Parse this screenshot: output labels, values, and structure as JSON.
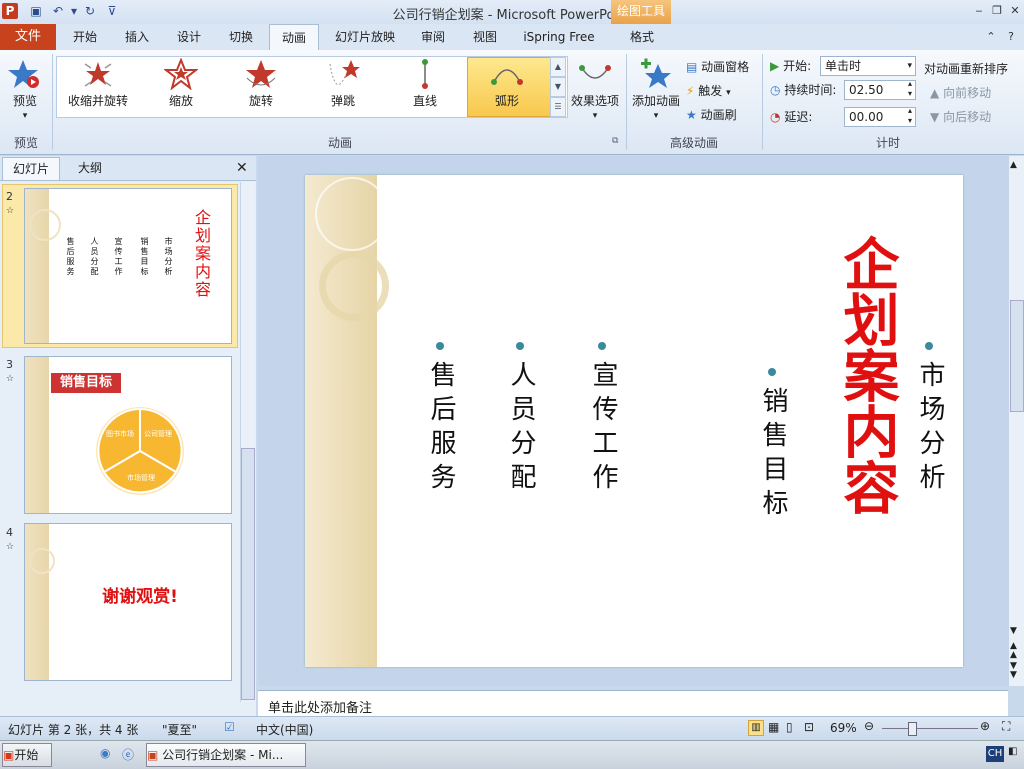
{
  "window": {
    "title": "公司行销企划案 - Microsoft PowerPoint",
    "contextual_tab": "绘图工具"
  },
  "tabs": [
    "文件",
    "开始",
    "插入",
    "设计",
    "切换",
    "动画",
    "幻灯片放映",
    "审阅",
    "视图",
    "iSpring Free",
    "格式"
  ],
  "active_tab": "动画",
  "ribbon": {
    "preview": {
      "label": "预览",
      "group": "预览"
    },
    "gallery_items": [
      "收缩并旋转",
      "缩放",
      "旋转",
      "弹跳",
      "直线",
      "弧形"
    ],
    "selected_effect": "弧形",
    "effect_options": "效果选项",
    "animation_group": "动画",
    "add_animation": "添加动画",
    "anim_pane": "动画窗格",
    "trigger": "触发",
    "anim_painter": "动画刷",
    "advanced_group": "高级动画",
    "start_label": "开始:",
    "start_value": "单击时",
    "duration_label": "持续时间:",
    "duration_value": "02.50",
    "delay_label": "延迟:",
    "delay_value": "00.00",
    "reorder_title": "对动画重新排序",
    "move_earlier": "向前移动",
    "move_later": "向后移动",
    "timing_group": "计时"
  },
  "left_pane": {
    "tab_slides": "幻灯片",
    "tab_outline": "大纲",
    "slides": [
      {
        "num": "2",
        "kind": "toc"
      },
      {
        "num": "3",
        "title": "销售目标",
        "pie_labels": [
          "图书市场",
          "公司管理",
          "市场管理"
        ]
      },
      {
        "num": "4",
        "text": "谢谢观赏!"
      }
    ]
  },
  "slide": {
    "title": "企划案内容",
    "columns": [
      "售后服务",
      "人员分配",
      "宣传工作",
      "销售目标",
      "市场分析"
    ]
  },
  "notes_placeholder": "单击此处添加备注",
  "status": {
    "slide_info": "幻灯片 第 2 张，共 4 张",
    "theme": "\"夏至\"",
    "language": "中文(中国)",
    "zoom": "69%"
  },
  "taskbar": {
    "start": "开始",
    "task": "公司行销企划案 - Mi...",
    "ime": "CH"
  },
  "colors": {
    "file_tab": "#c8421e",
    "title_red": "#e01010",
    "bullet": "#3a8a9a"
  }
}
